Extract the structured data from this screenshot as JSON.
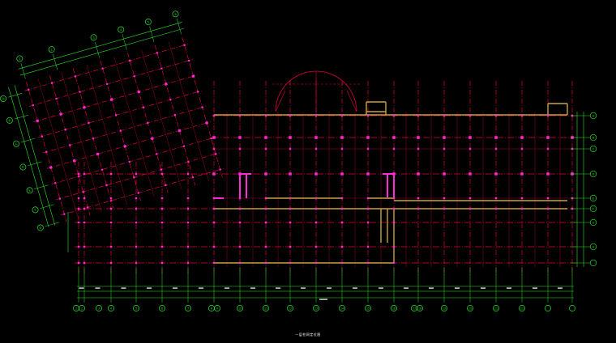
{
  "window": {
    "background": "#000000"
  },
  "drawing": {
    "title": "一层柱网定位图",
    "colors": {
      "grid_line": "#e4003a",
      "grid_line_dim": "#9b0026",
      "column": "#ff2bd6",
      "wall": "#c9a23c",
      "dimension": "#29e629",
      "axis_bubble": "#29e629",
      "label": "#ffffff"
    },
    "bottom_axis_labels": [
      "1",
      "2",
      "3",
      "4",
      "5",
      "6",
      "7",
      "8",
      "9",
      "10",
      "11",
      "12",
      "13",
      "14",
      "15",
      "16",
      "17",
      "18",
      "19",
      "20",
      "21",
      "22"
    ],
    "right_axis_labels": [
      "A",
      "B",
      "C",
      "D",
      "E",
      "F",
      "G",
      "H"
    ],
    "rotated_top_axis_labels": [
      "1",
      "2",
      "3",
      "4",
      "5",
      "6"
    ],
    "rotated_left_axis_labels": [
      "A",
      "B",
      "C",
      "D",
      "E",
      "F",
      "G"
    ]
  }
}
